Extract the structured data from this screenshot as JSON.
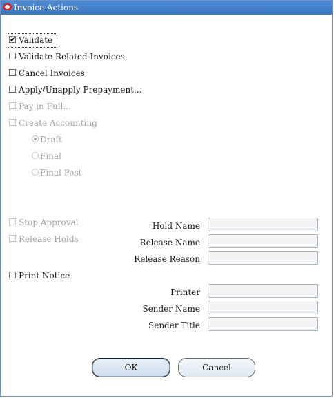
{
  "window": {
    "title": "Invoice Actions"
  },
  "actions": {
    "validate": {
      "label": "Validate",
      "checked": true
    },
    "validate_related": {
      "label": "Validate Related Invoices",
      "checked": false
    },
    "cancel_invoices": {
      "label": "Cancel Invoices",
      "checked": false
    },
    "apply_prepayment": {
      "label": "Apply/Unapply Prepayment...",
      "checked": false
    },
    "pay_in_full": {
      "label": "Pay in Full...",
      "checked": false,
      "enabled": false
    },
    "create_accounting": {
      "label": "Create Accounting",
      "checked": false,
      "enabled": false
    },
    "accounting_modes": [
      {
        "label": "Draft",
        "selected": true,
        "enabled": false
      },
      {
        "label": "Final",
        "selected": false,
        "enabled": false
      },
      {
        "label": "Final Post",
        "selected": false,
        "enabled": false
      }
    ],
    "stop_approval": {
      "label": "Stop Approval",
      "checked": false,
      "enabled": false
    },
    "release_holds": {
      "label": "Release Holds",
      "checked": false,
      "enabled": false
    },
    "print_notice": {
      "label": "Print Notice",
      "checked": false
    }
  },
  "fields": {
    "hold_name": {
      "label": "Hold Name",
      "value": ""
    },
    "release_name": {
      "label": "Release Name",
      "value": ""
    },
    "release_reason": {
      "label": "Release Reason",
      "value": ""
    },
    "printer": {
      "label": "Printer",
      "value": ""
    },
    "sender_name": {
      "label": "Sender Name",
      "value": ""
    },
    "sender_title": {
      "label": "Sender Title",
      "value": ""
    }
  },
  "buttons": {
    "ok": "OK",
    "cancel": "Cancel"
  }
}
